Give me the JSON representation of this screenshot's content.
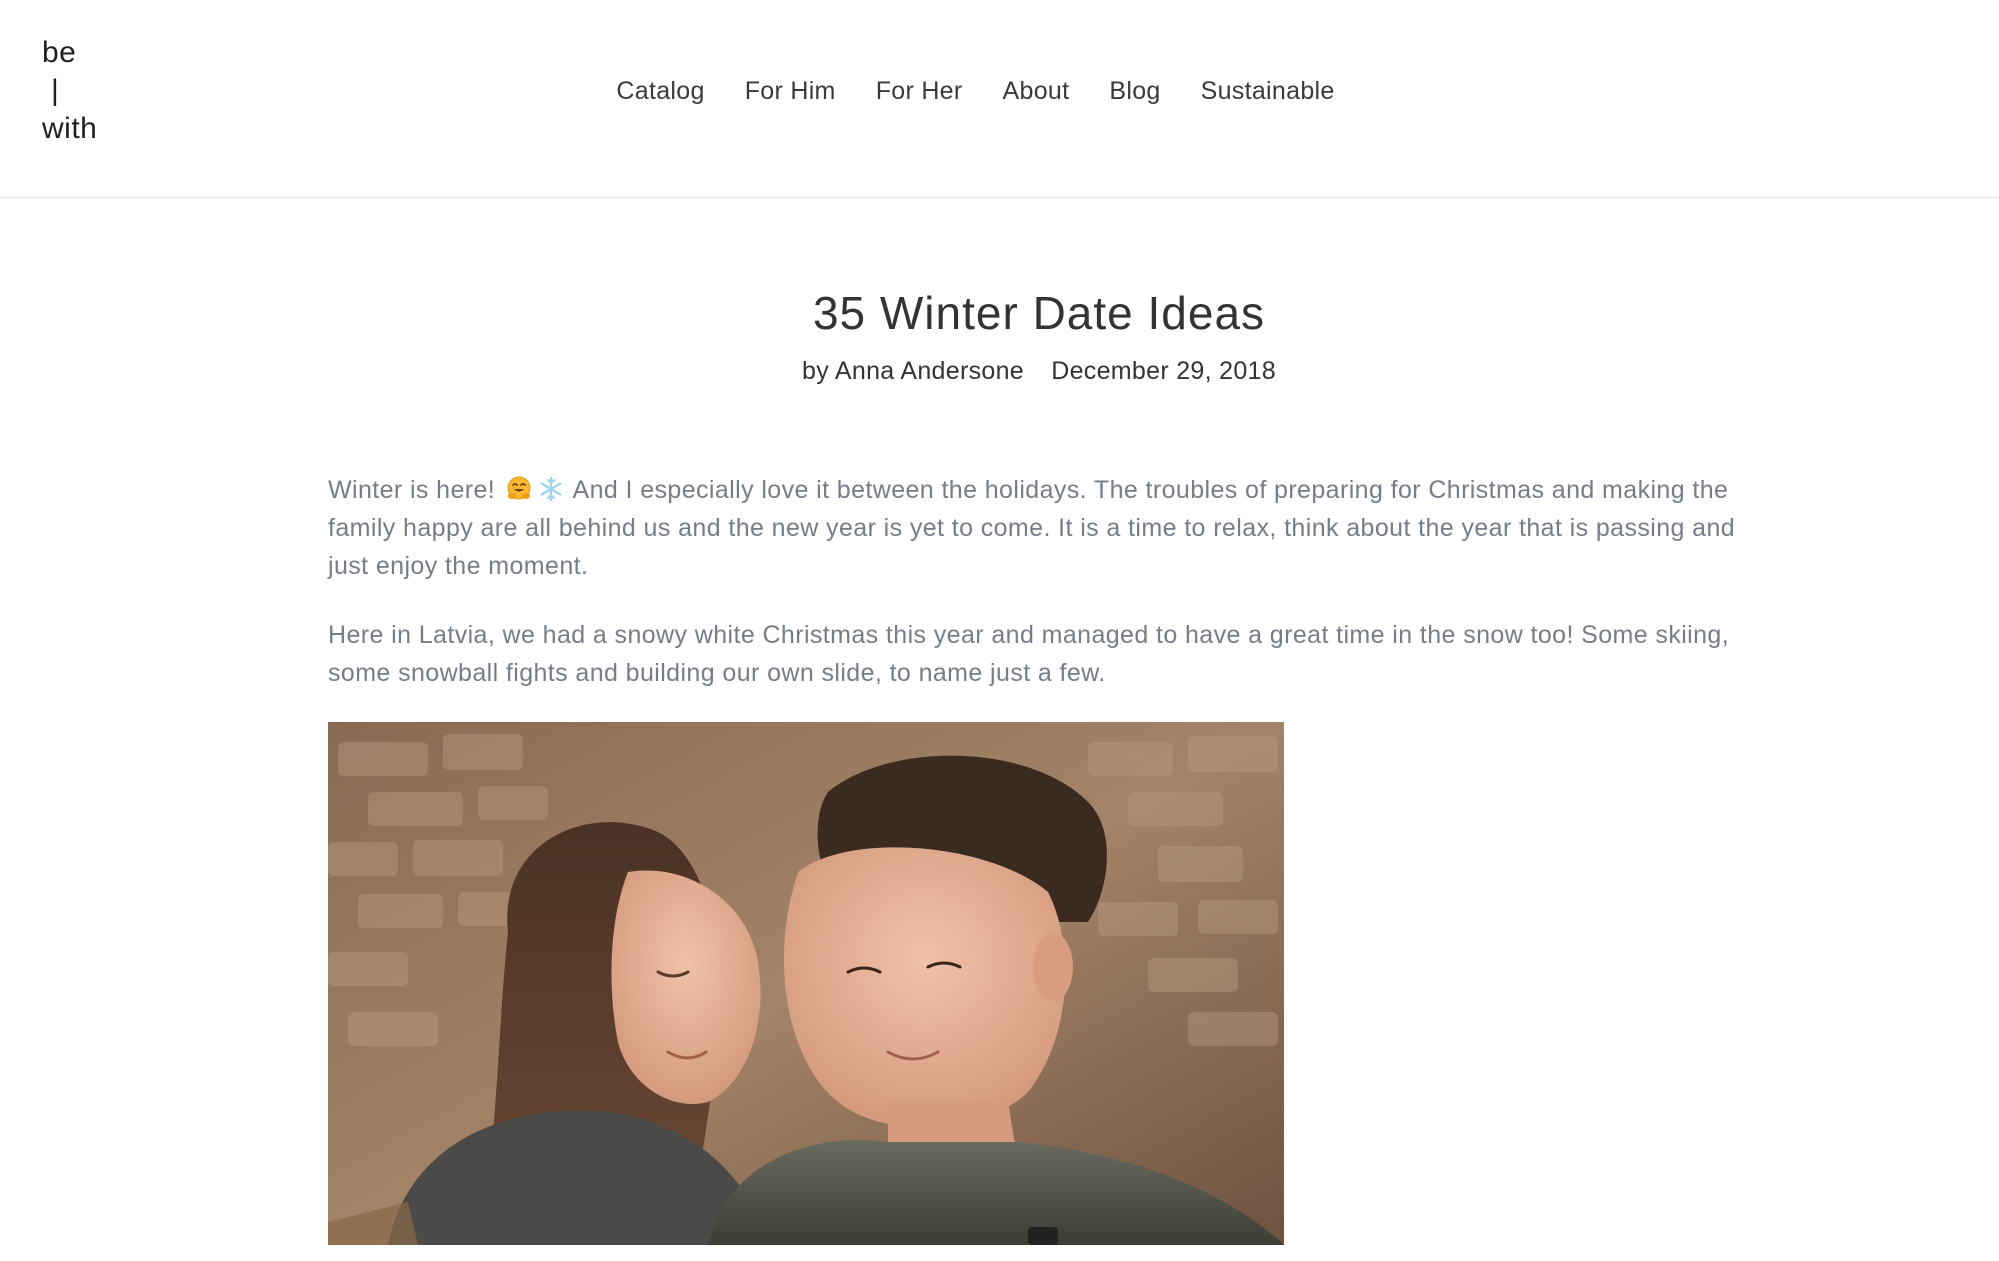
{
  "header": {
    "logo": {
      "line1": "be",
      "line2": "|",
      "line3": "with"
    },
    "nav": [
      {
        "label": "Catalog"
      },
      {
        "label": "For Him"
      },
      {
        "label": "For Her"
      },
      {
        "label": "About"
      },
      {
        "label": "Blog"
      },
      {
        "label": "Sustainable"
      }
    ]
  },
  "article": {
    "title": "35 Winter Date Ideas",
    "author": "by Anna Andersone",
    "date": "December 29, 2018",
    "paragraph1": {
      "lead": "Winter is here!",
      "emoji1": "hugging-face-emoji",
      "emoji2": "snowflake-emoji",
      "rest": " And I especially love it between the holidays. The troubles of preparing for Christmas and making the family happy are all behind us and the new year is yet to come. It is a time to relax, think about the year that is passing and just enjoy the moment."
    },
    "paragraph2": "Here in Latvia, we had a snowy white Christmas this year and managed to have a great time in the snow too! Some skiing, some snowball fights and building our own slide, to name just a few.",
    "image": {
      "subject": "couple-photo"
    }
  },
  "colors": {
    "text_dark": "#333333",
    "text_body": "#767d86",
    "divider": "#e6e6e6",
    "background": "#ffffff"
  }
}
